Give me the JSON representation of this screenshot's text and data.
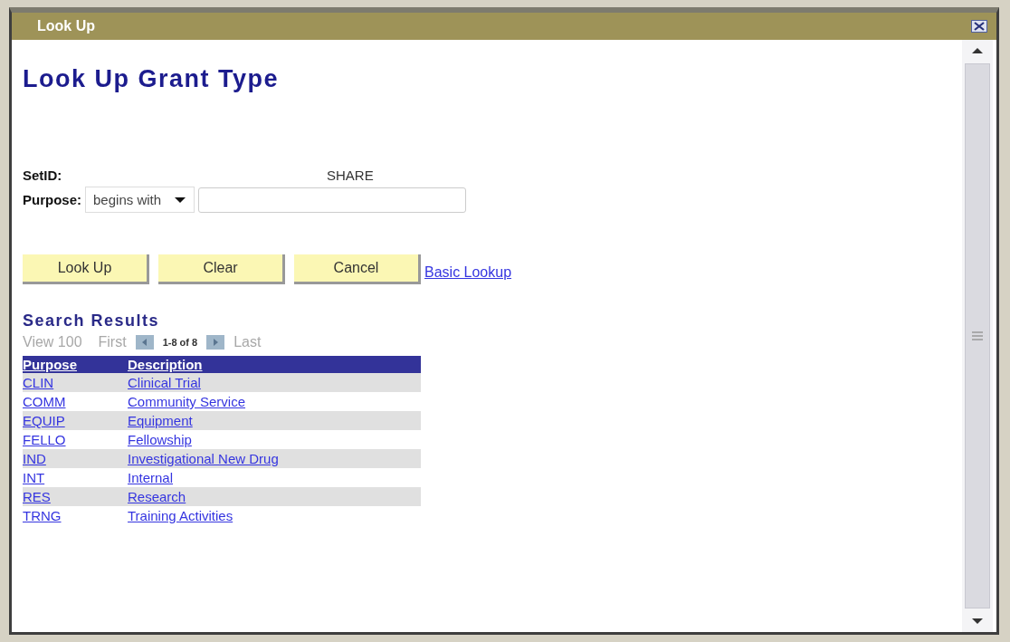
{
  "window": {
    "title": "Look Up"
  },
  "heading": "Look Up Grant Type",
  "fields": [
    {
      "kind": "static",
      "label": "SetID:",
      "value": "SHARE"
    },
    {
      "kind": "search",
      "label": "Purpose:",
      "operator": "begins with"
    }
  ],
  "buttons": [
    "Look Up",
    "Clear",
    "Cancel"
  ],
  "link": "Basic Lookup",
  "results": {
    "title": "Search Results",
    "navigation": {
      "view": "View 100",
      "first": "First",
      "range": "1-8 of 8",
      "last": "Last",
      "disabled": true
    },
    "columns": [
      "Purpose",
      "Description"
    ],
    "rows": [
      [
        "CLIN",
        "Clinical Trial"
      ],
      [
        "COMM",
        "Community Service"
      ],
      [
        "EQUIP",
        "Equipment"
      ],
      [
        "FELLO",
        "Fellowship"
      ],
      [
        "IND",
        "Investigational New Drug"
      ],
      [
        "INT",
        "Internal"
      ],
      [
        "RES",
        "Research"
      ],
      [
        "TRNG",
        "Training Activities"
      ]
    ]
  }
}
